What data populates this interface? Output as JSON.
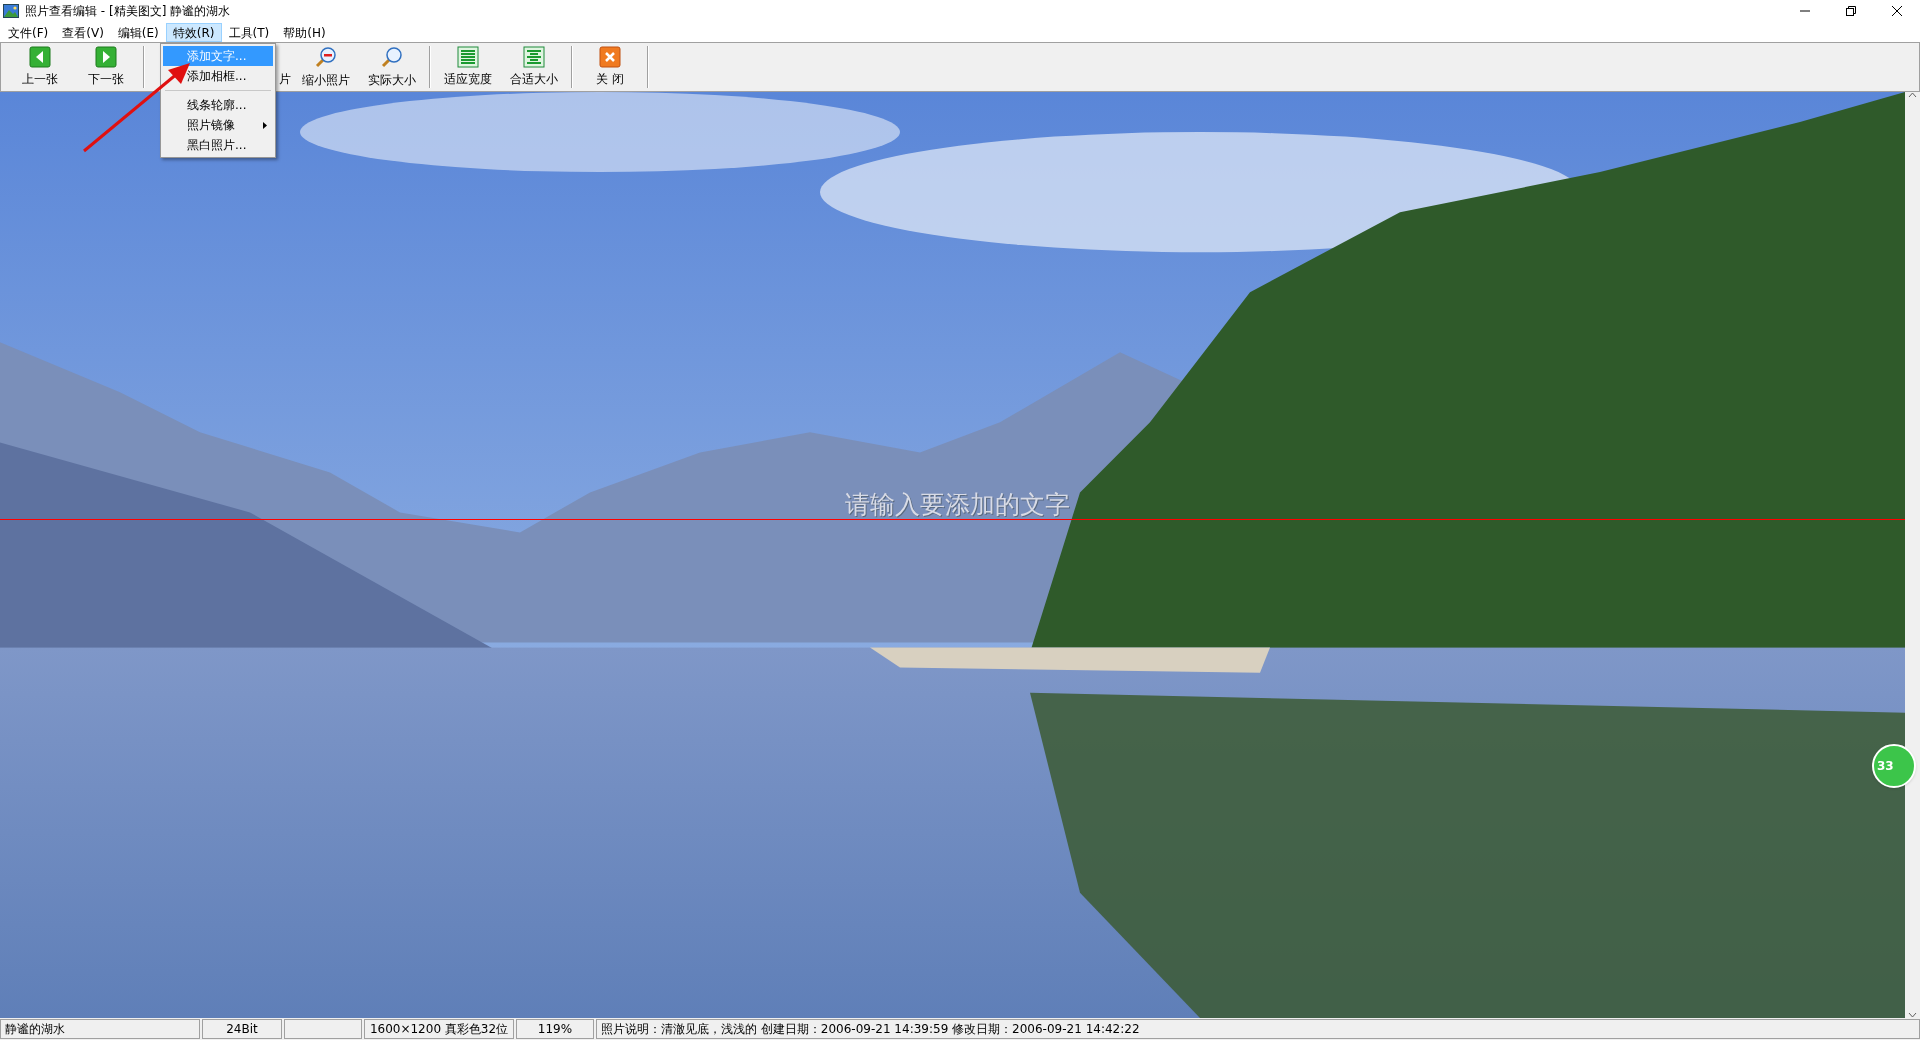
{
  "window": {
    "title": "照片查看编辑 - [精美图文] 静谧的湖水"
  },
  "menu_bar": [
    {
      "label": "文件(F)",
      "selected": false
    },
    {
      "label": "查看(V)",
      "selected": false
    },
    {
      "label": "编辑(E)",
      "selected": false
    },
    {
      "label": "特效(R)",
      "selected": true
    },
    {
      "label": "工具(T)",
      "selected": false
    },
    {
      "label": "帮助(H)",
      "selected": false
    }
  ],
  "toolbar": [
    [
      {
        "kind": "prev",
        "label": "上一张"
      },
      {
        "kind": "next",
        "label": "下一张"
      }
    ],
    [
      {
        "kind": "hidden",
        "label": "片"
      },
      {
        "kind": "zoom-out",
        "label": "缩小照片"
      },
      {
        "kind": "actual",
        "label": "实际大小"
      }
    ],
    [
      {
        "kind": "fit-width",
        "label": "适应宽度"
      },
      {
        "kind": "fit",
        "label": "合适大小"
      }
    ],
    [
      {
        "kind": "close",
        "label": "关 闭"
      }
    ]
  ],
  "dropdown_menu": [
    [
      {
        "label": "添加文字...",
        "selected": true,
        "submenu": false
      },
      {
        "label": "添加相框...",
        "selected": false,
        "submenu": false
      }
    ],
    [
      {
        "label": "线条轮廓...",
        "selected": false,
        "submenu": false
      },
      {
        "label": "照片镜像",
        "selected": false,
        "submenu": true
      },
      {
        "label": "黑白照片...",
        "selected": false,
        "submenu": false
      }
    ]
  ],
  "canvas": {
    "overlay_text": "请输入要添加的文字",
    "badge": "33"
  },
  "status_bar": [
    "静谧的湖水",
    "24Bit",
    "1600×1200 真彩色32位",
    "119%",
    "照片说明：清澈见底，浅浅的 创建日期：2006-09-21 14:39:59 修改日期：2006-09-21 14:42:22"
  ]
}
